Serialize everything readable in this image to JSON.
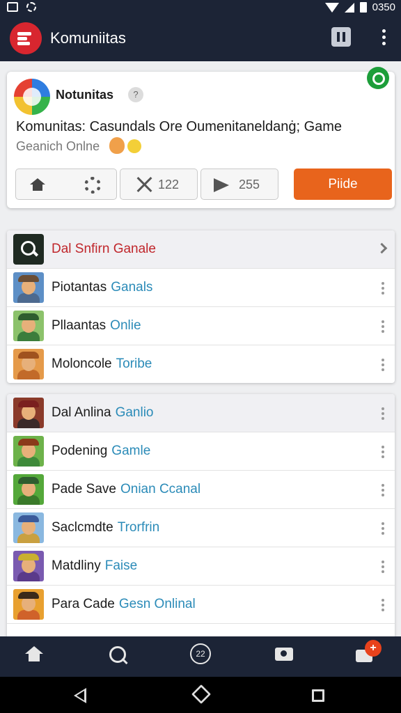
{
  "status_bar": {
    "time": "0350"
  },
  "app_bar": {
    "title": "Komuniitas"
  },
  "post": {
    "name": "Notunitas",
    "help": "?",
    "text": "Komunitas: Casundals Ore Oumenitaneldanġ; Game",
    "subtext": "Geanich Onlne",
    "actions": {
      "count1": "122",
      "count2": "255",
      "primary": "Piide"
    }
  },
  "list1": {
    "header": "Dal Snfirn Ganale",
    "rows": [
      {
        "name": "Piotantas",
        "tag": "Ganals",
        "hat": "#6b4e35",
        "shirt": "#4d6a8f",
        "bg": "#5d8fc6"
      },
      {
        "name": "Pllaantas",
        "tag": "Onlie",
        "hat": "#2f5d2f",
        "shirt": "#3c7d3c",
        "bg": "#8cc26b"
      },
      {
        "name": "Moloncole",
        "tag": "Toribe",
        "hat": "#a0521e",
        "shirt": "#c26a2a",
        "bg": "#e59a4a"
      }
    ]
  },
  "list2": {
    "rows": [
      {
        "name": "Dal Anlina",
        "tag": "Ganlio",
        "hat": "#7a1f1f",
        "shirt": "#3a2a2a",
        "bg": "#8a3a2a"
      },
      {
        "name": "Podening",
        "tag": "Gamle",
        "hat": "#8a3a1a",
        "shirt": "#3e8a3a",
        "bg": "#6db24a"
      },
      {
        "name": "Pade Save",
        "tag": "Onian Ccanal",
        "hat": "#2f5d2f",
        "shirt": "#3a7a2a",
        "bg": "#54a83a"
      },
      {
        "name": "Saclcmdte",
        "tag": "Trorfrin",
        "hat": "#3a5a9a",
        "shirt": "#c9a040",
        "bg": "#8ab8e0"
      },
      {
        "name": "Matdliny",
        "tag": "Faise",
        "hat": "#c9b030",
        "shirt": "#5a3a8a",
        "bg": "#7a5ab0"
      },
      {
        "name": "Para Cade",
        "tag": "Gesn Onlinal",
        "hat": "#3a2a1a",
        "shirt": "#d0622a",
        "bg": "#e8a030"
      }
    ]
  },
  "bottom_nav": {
    "game_label": "22",
    "badge": "+"
  },
  "colors": {
    "bar": "#1c2436",
    "accent": "#e8641c",
    "link": "#2b8bb8",
    "header_link": "#c0262b"
  },
  "icons": [
    "search-icon",
    "home-icon",
    "gear-icon",
    "close-icon",
    "share-icon",
    "camera-icon",
    "chevron-right-icon",
    "more-icon"
  ]
}
